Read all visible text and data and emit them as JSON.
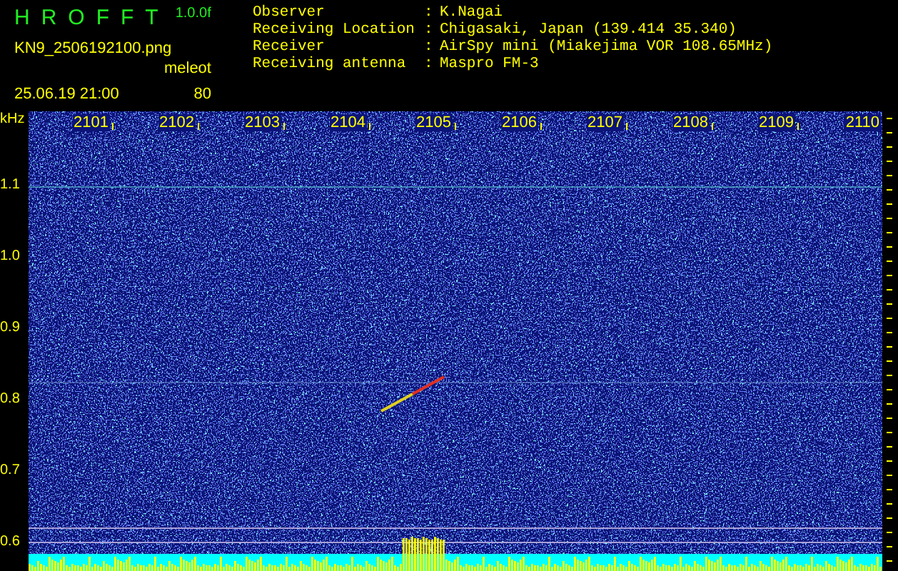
{
  "header": {
    "title": "HROFFT",
    "version": "1.0.0f",
    "file_name": "KN9_2506192100.png",
    "timestamp": "25.06.19 21:00",
    "count_label": "meleot",
    "count": "80"
  },
  "station_info": [
    {
      "label": "Observer",
      "separator": ":",
      "value": "K.Nagai"
    },
    {
      "label": "Receiving Location",
      "separator": ":",
      "value": "Chigasaki, Japan (139.414 35.340)"
    },
    {
      "label": "Receiver",
      "separator": ":",
      "value": "AirSpy mini (Miakejima VOR 108.65MHz)"
    },
    {
      "label": "Receiving antenna",
      "separator": ":",
      "value": "Maspro FM-3"
    }
  ],
  "spectrogram": {
    "unit": "kHz",
    "time_labels": [
      "2101",
      "2102",
      "2103",
      "2104",
      "2105",
      "2106",
      "2107",
      "2108",
      "2109",
      "2110"
    ],
    "frequency_labels": [
      "1.1",
      "1.0",
      "0.9",
      "0.8",
      "0.7",
      "0.6"
    ]
  }
}
